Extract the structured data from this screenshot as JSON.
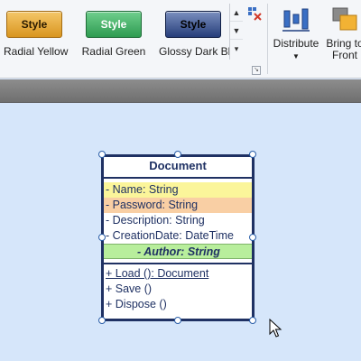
{
  "ribbon": {
    "gallery": [
      {
        "swatch_label": "Style",
        "caption": "Radial Yellow"
      },
      {
        "swatch_label": "Style",
        "caption": "Radial Green"
      },
      {
        "swatch_label": "Style",
        "caption": "Glossy Dark Bl"
      }
    ],
    "distribute": {
      "label": "Distribute"
    },
    "bring_to_front": {
      "label_line1": "Bring to",
      "label_line2": "Front"
    }
  },
  "uml_class": {
    "title": "Document",
    "attributes": [
      "- Name: String",
      "- Password: String",
      "- Description: String",
      "- CreationDate: DateTime",
      "- Author: String"
    ],
    "operations": [
      "+ Load (): Document",
      "+ Save ()",
      "+ Dispose ()"
    ]
  },
  "colors": {
    "class_border": "#1f3163",
    "highlight_yellow": "#fbf59a",
    "highlight_peach": "#f9cfa4",
    "highlight_green": "#b8ee9c",
    "canvas": "#d6e6fa"
  }
}
